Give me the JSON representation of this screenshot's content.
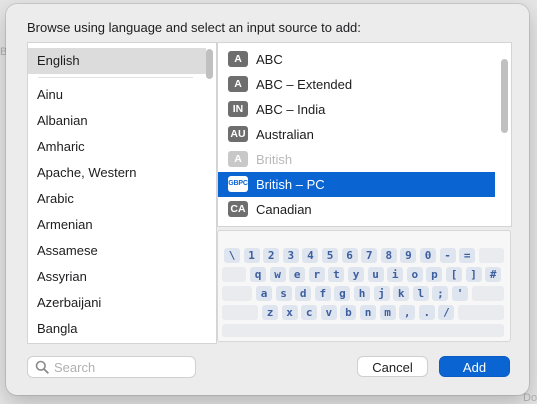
{
  "background_text": {
    "left_fragment": "Br",
    "right_fragment": "Do"
  },
  "dialog": {
    "prompt": "Browse using language and select an input source to add:"
  },
  "languages": [
    {
      "label": "English",
      "selected": true
    },
    {
      "label": "Ainu"
    },
    {
      "label": "Albanian"
    },
    {
      "label": "Amharic"
    },
    {
      "label": "Apache, Western"
    },
    {
      "label": "Arabic"
    },
    {
      "label": "Armenian"
    },
    {
      "label": "Assamese"
    },
    {
      "label": "Assyrian"
    },
    {
      "label": "Azerbaijani"
    },
    {
      "label": "Bangla"
    }
  ],
  "sources": [
    {
      "badge": "A",
      "label": "ABC",
      "state": "normal"
    },
    {
      "badge": "A",
      "label": "ABC – Extended",
      "state": "normal"
    },
    {
      "badge": "IN",
      "label": "ABC – India",
      "state": "normal"
    },
    {
      "badge": "AU",
      "label": "Australian",
      "state": "normal"
    },
    {
      "badge": "A",
      "label": "British",
      "state": "disabled"
    },
    {
      "badge": "GBPC",
      "label": "British – PC",
      "state": "selected"
    },
    {
      "badge": "CA",
      "label": "Canadian",
      "state": "normal"
    }
  ],
  "keyboard": {
    "rows": [
      [
        "\\",
        "1",
        "2",
        "3",
        "4",
        "5",
        "6",
        "7",
        "8",
        "9",
        "0",
        "-",
        "="
      ],
      [
        "q",
        "w",
        "e",
        "r",
        "t",
        "y",
        "u",
        "i",
        "o",
        "p",
        "[",
        "]",
        "#"
      ],
      [
        "a",
        "s",
        "d",
        "f",
        "g",
        "h",
        "j",
        "k",
        "l",
        ";",
        "'"
      ],
      [
        "z",
        "x",
        "c",
        "v",
        "b",
        "n",
        "m",
        ",",
        ".",
        "/"
      ]
    ]
  },
  "search": {
    "placeholder": "Search",
    "value": ""
  },
  "buttons": {
    "cancel": "Cancel",
    "add": "Add"
  },
  "colors": {
    "accent": "#0a64d2",
    "key_text": "#3d5fa0",
    "key_bg": "#dfe5ef"
  }
}
